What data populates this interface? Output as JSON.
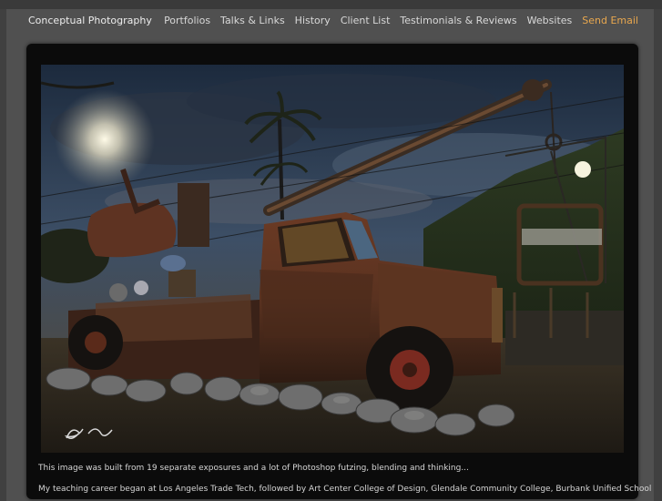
{
  "header": {
    "site_title": "Conceptual Photography",
    "nav": [
      {
        "label": "Portfolios"
      },
      {
        "label": "Talks & Links"
      },
      {
        "label": "History"
      },
      {
        "label": "Client List"
      },
      {
        "label": "Testimonials & Reviews"
      },
      {
        "label": "Websites"
      },
      {
        "label": "Send Email"
      }
    ]
  },
  "main": {
    "photo": {
      "subject": "rusted-tow-truck-photo",
      "signature": "SC"
    },
    "caption_1": "This image was built from 19 separate exposures and a lot of Photoshop futzing, blending and thinking...",
    "caption_2": "My teaching career began at Los Angeles Trade Tech, followed by Art Center College of Design, Glendale Community College, Burbank Unified School"
  },
  "colors": {
    "page_bg": "#404040",
    "frame_bg": "#505050",
    "panel_bg": "#0b0b0b",
    "accent": "#e8a74e"
  }
}
